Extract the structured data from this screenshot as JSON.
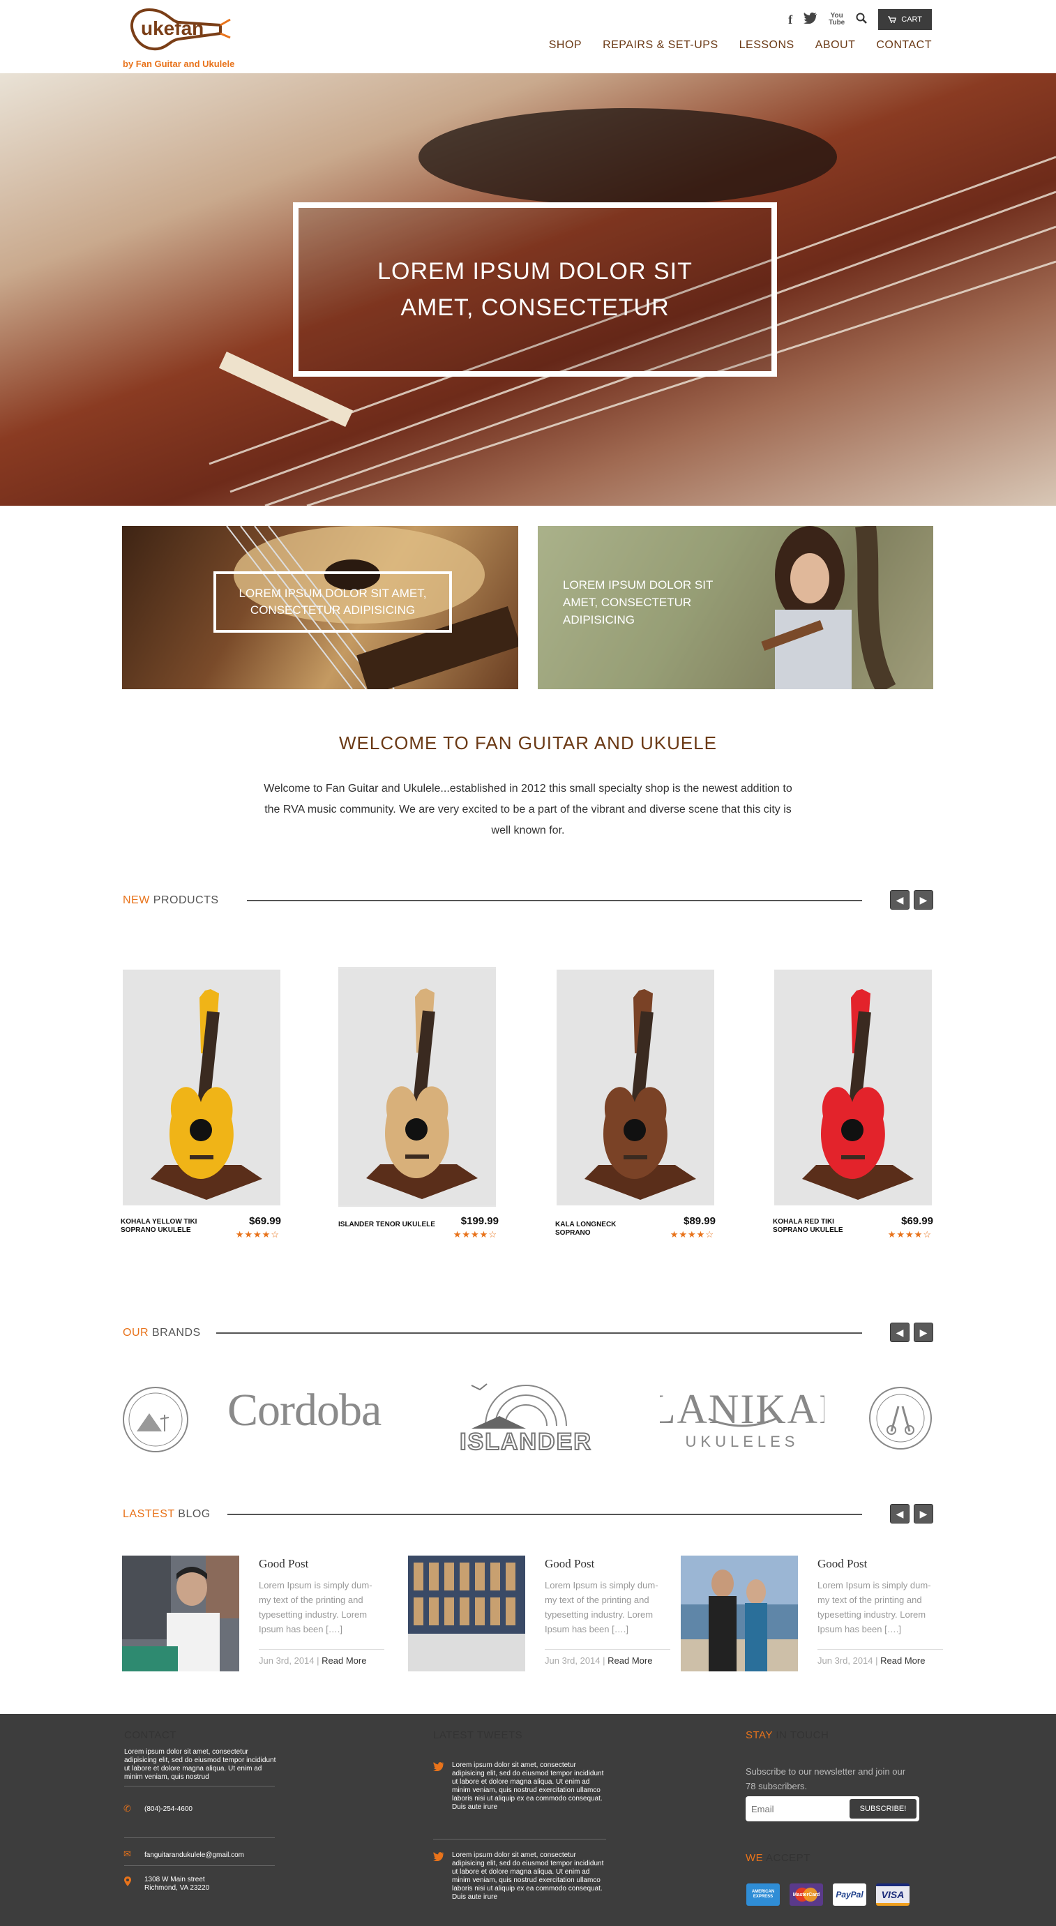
{
  "header": {
    "logo_text": "ukefan",
    "logo_tagline": "by Fan Guitar and Ukulele",
    "youtube_top": "You",
    "youtube_bottom": "Tube",
    "cart_label": "CART",
    "nav": [
      "SHOP",
      "REPAIRS & SET-UPS",
      "LESSONS",
      "ABOUT",
      "CONTACT"
    ]
  },
  "hero": {
    "headline": "LOREM IPSUM DOLOR SIT AMET, CONSECTETUR"
  },
  "promos": [
    {
      "text": "LOREM IPSUM DOLOR SIT AMET, CONSECTETUR ADIPISICING"
    },
    {
      "text": "LOREM IPSUM DOLOR SIT AMET, CONSECTETUR ADIPISICING"
    }
  ],
  "welcome": {
    "title": "WELCOME TO FAN GUITAR AND UKUELE",
    "text": "Welcome to Fan Guitar and Ukulele...established in 2012 this small specialty shop is the newest addition to the RVA music community. We are very excited to be a part of the vibrant and diverse scene that this city is well known for."
  },
  "new_products": {
    "title_accent": "NEW",
    "title_rest": " PRODUCTS",
    "items": [
      {
        "name": "KOHALA YELLOW TIKI SOPRANO UKULELE",
        "price": "$69.99",
        "rating": 3.5,
        "color": "#f0b417"
      },
      {
        "name": "ISLANDER TENOR UKULELE",
        "price": "$199.99",
        "rating": 3.5,
        "color": "#d8b07a"
      },
      {
        "name": "KALA LONGNECK SOPRANO",
        "price": "$89.99",
        "rating": 3.5,
        "color": "#7a4226"
      },
      {
        "name": "KOHALA RED TIKI SOPRANO UKULELE",
        "price": "$69.99",
        "rating": 3.5,
        "color": "#e3232b"
      }
    ]
  },
  "brands": {
    "title_accent": "OUR",
    "title_rest": " BRANDS",
    "items": [
      "Cordoba",
      "ISLANDER",
      "LANIKAI",
      "UKULELES"
    ]
  },
  "blog": {
    "title_accent": "LASTEST",
    "title_rest": " BLOG",
    "posts": [
      {
        "title": "Good Post",
        "excerpt": "Lorem Ipsum is simply dum-my text of the printing and typesetting industry. Lorem Ipsum has been [….]",
        "date": "Jun 3rd, 2014",
        "more": "Read More"
      },
      {
        "title": "Good Post",
        "excerpt": "Lorem Ipsum is simply dum-my text of the printing and typesetting industry. Lorem Ipsum has been [….]",
        "date": "Jun 3rd, 2014",
        "more": "Read More"
      },
      {
        "title": "Good Post",
        "excerpt": "Lorem Ipsum is simply dum-my text of the printing and typesetting industry. Lorem Ipsum has been [….]",
        "date": "Jun 3rd, 2014",
        "more": "Read More"
      }
    ]
  },
  "footer": {
    "contact": {
      "title": "CONTACT",
      "text": "Lorem ipsum dolor sit amet, consectetur adipisicing elit, sed do eiusmod tempor incididunt ut labore et dolore magna aliqua. Ut enim ad minim veniam, quis nostrud",
      "phone": "(804)-254-4600",
      "email": "fanguitarandukulele@gmail.com",
      "address_line1": "1308 W Main street",
      "address_line2": "Richmond, VA 23220"
    },
    "tweets": {
      "title": "LATEST TWEETS",
      "items": [
        "Lorem ipsum dolor sit amet, consectetur adipisicing elit, sed do eiusmod tempor incididunt ut labore et dolore magna aliqua. Ut enim ad minim veniam, quis nostrud exercitation ullamco laboris nisi ut aliquip ex ea commodo consequat. Duis aute irure",
        "Lorem ipsum dolor sit amet, consectetur adipisicing elit, sed do eiusmod tempor incididunt ut labore et dolore magna aliqua. Ut enim ad minim veniam, quis nostrud exercitation ullamco laboris nisi ut aliquip ex ea commodo consequat. Duis aute irure"
      ]
    },
    "stay": {
      "title_accent": "STAY",
      "title_rest": " IN TOUCH",
      "text": "Subscribe to our newsletter and join our 78 subscribers.",
      "email_placeholder": "Email",
      "subscribe_label": "SUBSCRIBE!"
    },
    "accept": {
      "title_accent": "WE",
      "title_rest": " ACCEPT",
      "cards": [
        "AMERICAN EXPRESS",
        "MasterCard",
        "PayPal",
        "VISA"
      ]
    }
  },
  "colors": {
    "accent": "#e8731b",
    "brown": "#6b3a16",
    "footer_bg": "#3d3d3d"
  }
}
